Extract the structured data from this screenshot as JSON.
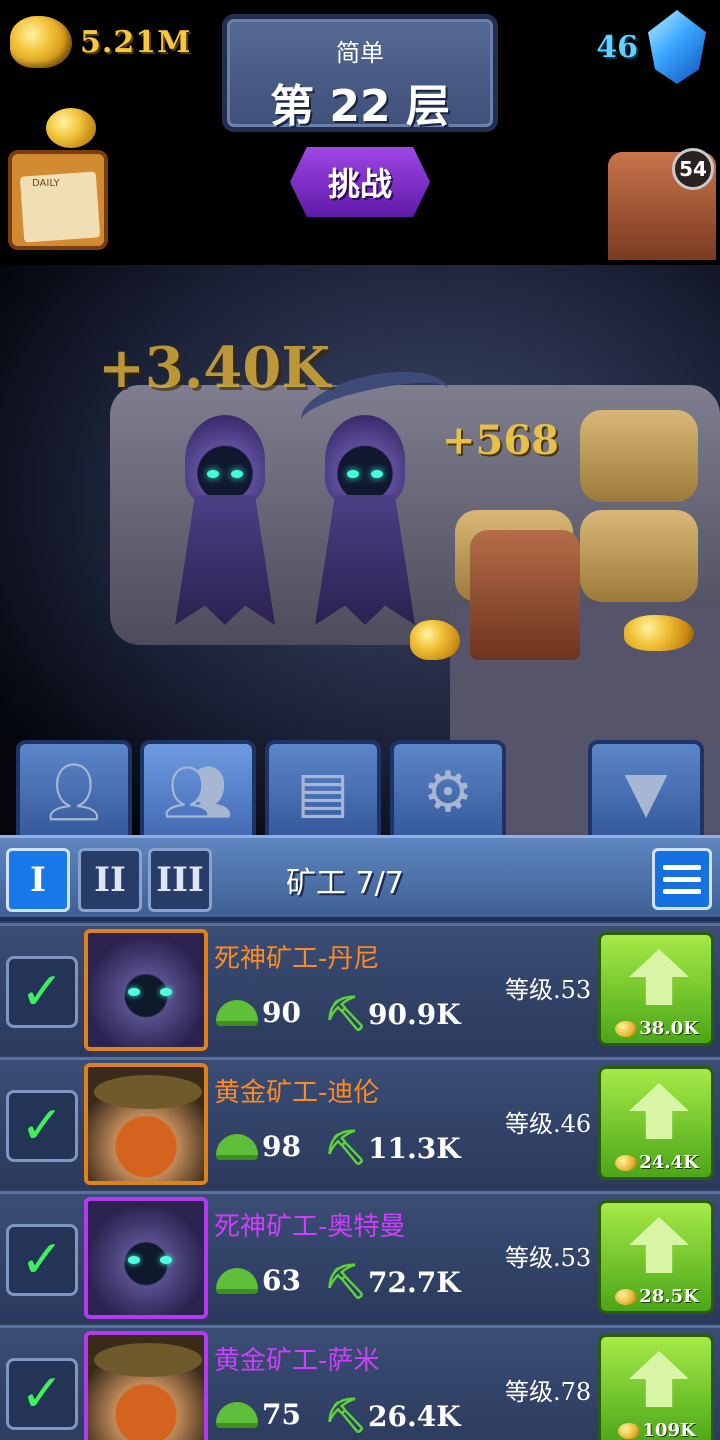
{
  "hud": {
    "gold": "5.21M",
    "gems": "46",
    "difficulty": "简单",
    "floor": "第 22 层",
    "daily_label": "DAILY",
    "challenge_label": "挑战",
    "robot_level": "54"
  },
  "scene": {
    "float_big": "+3.40K",
    "float_small": "+568"
  },
  "actions": {
    "icons": [
      "person-icon",
      "group-pick-icon",
      "chest-icon",
      "gear-icon",
      "triangle-down-icon"
    ]
  },
  "panel": {
    "tabs": [
      "I",
      "II",
      "III"
    ],
    "title": "矿工 7/7",
    "miners": [
      {
        "name": "死神矿工-丹尼",
        "name_color": "#ff8a1e",
        "capacity": "90",
        "speed": "90.9K",
        "level": "等级.53",
        "upgrade_cost": "38.0K",
        "portrait": "reaper-icon"
      },
      {
        "name": "黄金矿工-迪伦",
        "name_color": "#ff8a1e",
        "capacity": "98",
        "speed": "11.3K",
        "level": "等级.46",
        "upgrade_cost": "24.4K",
        "portrait": "dwarf-icon"
      },
      {
        "name": "死神矿工-奥特曼",
        "name_color": "#d23cff",
        "capacity": "63",
        "speed": "72.7K",
        "level": "等级.53",
        "upgrade_cost": "28.5K",
        "portrait": "reaper-icon"
      },
      {
        "name": "黄金矿工-萨米",
        "name_color": "#d23cff",
        "capacity": "75",
        "speed": "26.4K",
        "level": "等级.78",
        "upgrade_cost": "109K",
        "portrait": "dwarf-icon"
      }
    ]
  }
}
